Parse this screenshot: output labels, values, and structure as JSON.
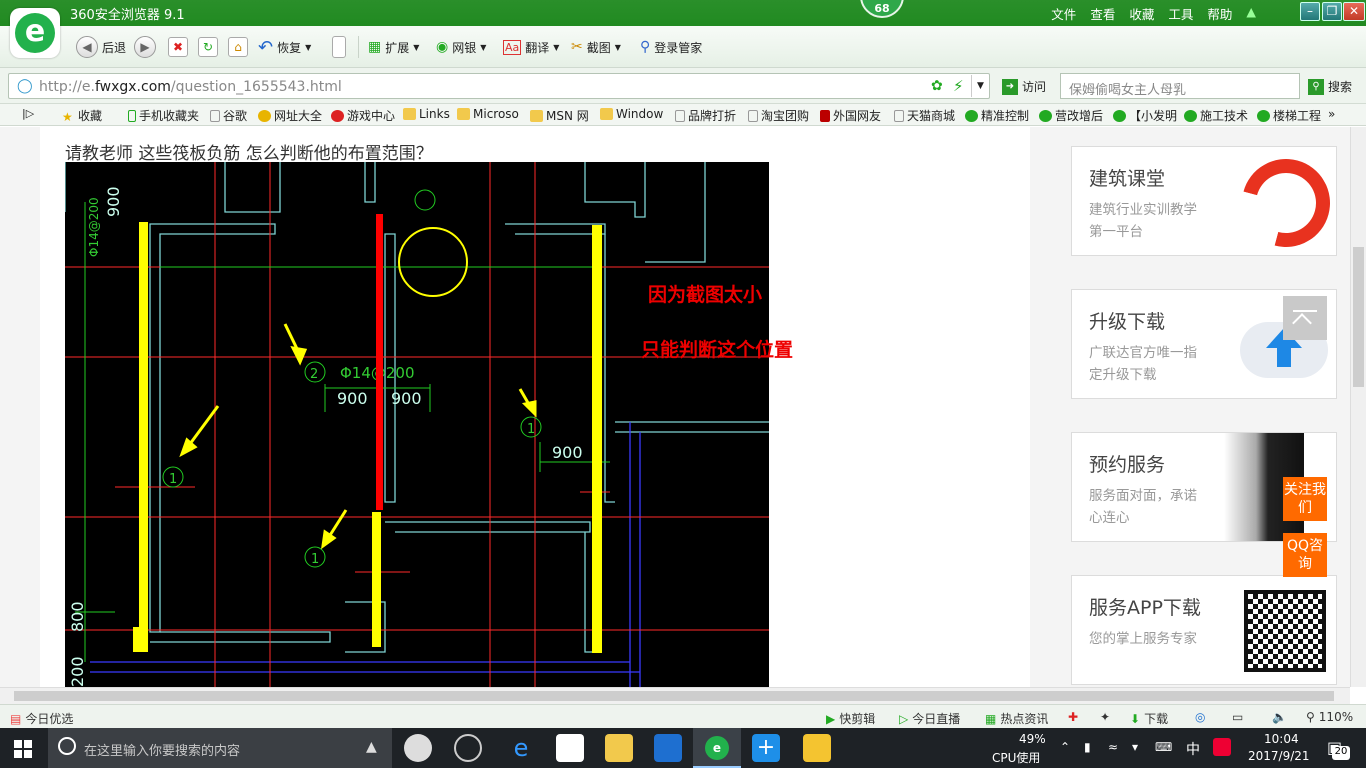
{
  "window": {
    "title": "360安全浏览器 9.1",
    "badge": "68",
    "menu": [
      "文件",
      "查看",
      "收藏",
      "工具",
      "帮助"
    ]
  },
  "toolbar": {
    "back": "后退",
    "restore": "恢复",
    "extend": "扩展",
    "bank": "网银",
    "translate": "翻译",
    "screenshot": "截图",
    "login_manager": "登录管家"
  },
  "address": {
    "url_prefix": "http://e.",
    "url_domain": "fwxgx.com",
    "url_path": "/question_1655543.html",
    "visit_label": "访问",
    "search_placeholder": "保姆偷喝女主人母乳",
    "search_label": "搜索"
  },
  "bookmarks": [
    "收藏",
    "手机收藏夹",
    "谷歌",
    "网址大全",
    "游戏中心",
    "Links",
    "Microso",
    "MSN 网",
    "Window",
    "品牌打折",
    "淘宝团购",
    "外国网友",
    "天猫商城",
    "精准控制",
    "营改增后",
    "【小发明",
    "施工技术",
    "楼梯工程"
  ],
  "question": {
    "title": "请教老师 这些筏板负筋 怎么判断他的布置范围？"
  },
  "cad": {
    "labels": {
      "top_rebar": "Φ14@200",
      "dim_900_top": "900",
      "mid_rebar": "Φ14@200",
      "dim_900_a": "900",
      "dim_900_b": "900",
      "dim_900_right": "900",
      "dim_800": "800",
      "dim_200": "200",
      "mark_1a": "1",
      "mark_1b": "1",
      "mark_1c": "1",
      "mark_2": "2"
    },
    "note_line1": "因为截图太小",
    "note_line2": "只能判断这个位置"
  },
  "sidebar": {
    "cards": [
      {
        "title": "建筑课堂",
        "desc": "建筑行业实训教学第一平台"
      },
      {
        "title": "升级下载",
        "desc": "广联达官方唯一指定升级下载"
      },
      {
        "title": "预约服务",
        "desc": "服务面对面，承诺心连心"
      },
      {
        "title": "服务APP下载",
        "desc": "您的掌上服务专家"
      }
    ],
    "follow": "关注我们",
    "qq": "QQ咨询"
  },
  "statusbar": {
    "today_pick": "今日优选",
    "clip": "快剪辑",
    "live": "今日直播",
    "news": "热点资讯",
    "download": "下载",
    "zoom": "110%"
  },
  "taskbar": {
    "search_placeholder": "在这里输入你要搜索的内容",
    "cpu_percent": "49%",
    "cpu_label": "CPU使用",
    "ime": "中",
    "time": "10:04",
    "date": "2017/9/21",
    "notifications": "20"
  },
  "colors": {
    "title_green": "#2a8f2a",
    "accent_orange": "#ff6a00",
    "cad_background": "#000000",
    "highlight_yellow": "#ffff00",
    "highlight_red": "#ff0000"
  }
}
